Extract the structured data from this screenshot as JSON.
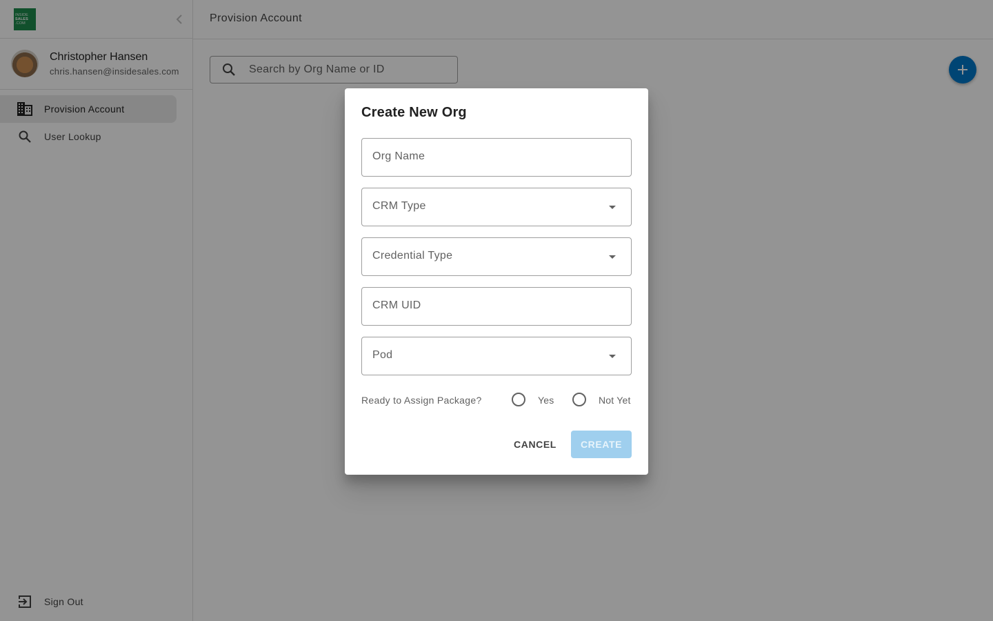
{
  "sidebar": {
    "logo": {
      "line1": "INSIDE",
      "line2": "SALES",
      "line3": ".COM"
    },
    "collapse_icon": "chevron-left-icon",
    "user": {
      "name": "Christopher Hansen",
      "email": "chris.hansen@insidesales.com"
    },
    "items": [
      {
        "label": "Provision Account",
        "icon": "building-icon",
        "active": true
      },
      {
        "label": "User Lookup",
        "icon": "search-icon",
        "active": false
      }
    ],
    "sign_out": {
      "label": "Sign Out",
      "icon": "exit-icon"
    }
  },
  "header": {
    "title": "Provision Account"
  },
  "search": {
    "placeholder": "Search by Org Name or ID",
    "value": ""
  },
  "fab": {
    "icon": "plus-icon",
    "color": "#0077c8"
  },
  "dialog": {
    "title": "Create New Org",
    "fields": [
      {
        "label": "Org Name",
        "type": "text",
        "value": ""
      },
      {
        "label": "CRM Type",
        "type": "select",
        "value": ""
      },
      {
        "label": "Credential Type",
        "type": "select",
        "value": ""
      },
      {
        "label": "CRM UID",
        "type": "text",
        "value": ""
      },
      {
        "label": "Pod",
        "type": "select",
        "value": ""
      }
    ],
    "radio_question": "Ready to Assign Package?",
    "radio_options": [
      {
        "label": "Yes",
        "selected": false
      },
      {
        "label": "Not Yet",
        "selected": false
      }
    ],
    "cancel_label": "CANCEL",
    "create_label": "CREATE",
    "create_disabled": true
  }
}
